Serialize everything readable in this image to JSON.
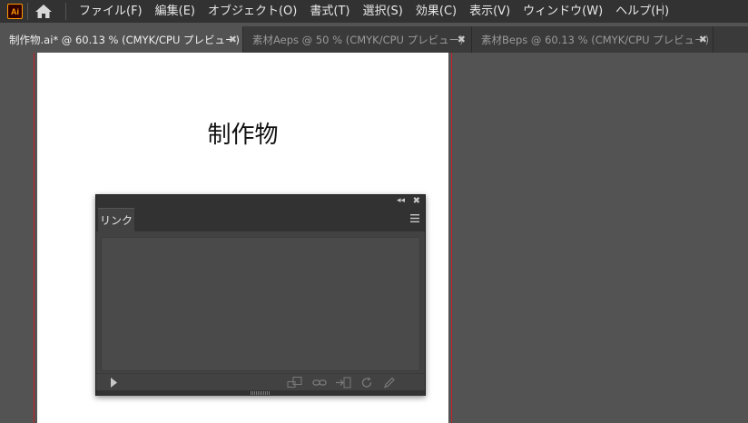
{
  "app": {
    "logo_text": "Ai",
    "logo_color": "#ff9a00"
  },
  "menu": {
    "items": [
      {
        "label": "ファイル(F)"
      },
      {
        "label": "編集(E)"
      },
      {
        "label": "オブジェクト(O)"
      },
      {
        "label": "書式(T)"
      },
      {
        "label": "選択(S)"
      },
      {
        "label": "効果(C)"
      },
      {
        "label": "表示(V)"
      },
      {
        "label": "ウィンドウ(W)"
      },
      {
        "label": "ヘルプ(H)"
      }
    ]
  },
  "tabs": [
    {
      "label": "制作物.ai* @ 60.13 % (CMYK/CPU プレビュー)",
      "close": "✖",
      "active": true
    },
    {
      "label": "素材Aeps @ 50 % (CMYK/CPU プレビュー)",
      "close": "✖",
      "active": false
    },
    {
      "label": "素材Beps @ 60.13 % (CMYK/CPU プレビュー)",
      "close": "✖",
      "active": false
    }
  ],
  "artboard": {
    "text": "制作物"
  },
  "links_panel": {
    "collapse_label": "◂◂",
    "close_label": "✖",
    "tab_label": "リンク",
    "footer_icons": [
      "play-icon",
      "relink-from-library-icon",
      "relink-icon",
      "go-to-link-icon",
      "update-link-icon",
      "edit-original-icon"
    ]
  },
  "colors": {
    "bleed": "#c8202a",
    "ui_dark": "#323232",
    "canvas": "#535353"
  }
}
